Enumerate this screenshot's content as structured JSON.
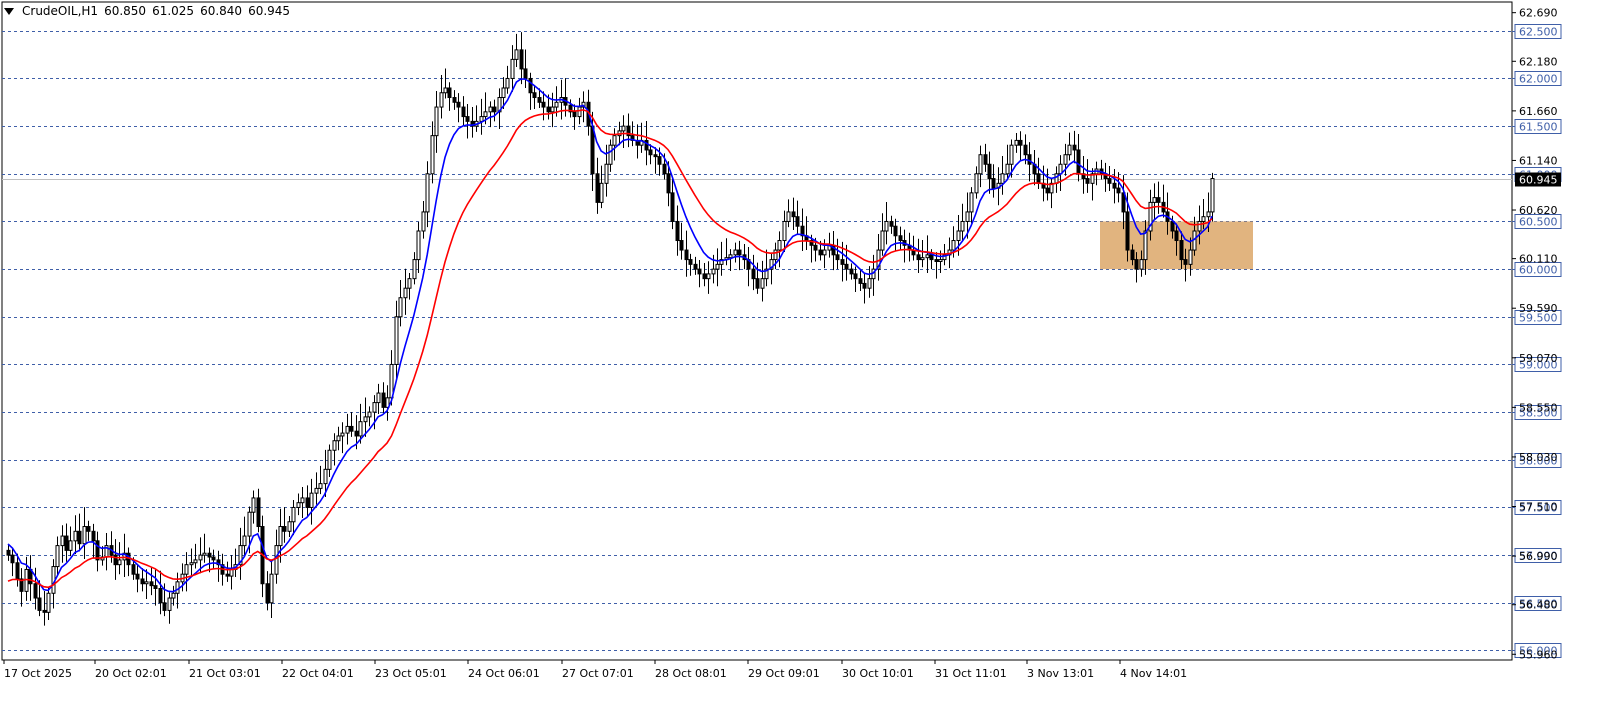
{
  "header": {
    "symbol": "CrudeOIL,H1",
    "open": "60.850",
    "high": "61.025",
    "low": "60.840",
    "close": "60.945"
  },
  "colors": {
    "grid": "#3f5fa8",
    "ema_fast": "#0000ff",
    "ema_slow": "#ff0000",
    "zone": "#d9a15f",
    "candle": "#000000",
    "price_line": "#c0c0c0"
  },
  "chart_data": {
    "type": "candlestick",
    "symbol": "CrudeOIL",
    "timeframe": "H1",
    "ylim": [
      55.9,
      62.76
    ],
    "y_ticks": [
      "62.690",
      "62.180",
      "61.660",
      "61.140",
      "60.620",
      "60.110",
      "59.590",
      "59.070",
      "58.550",
      "58.030",
      "57.510",
      "56.990",
      "56.480",
      "55.960"
    ],
    "level_lines": [
      "62.500",
      "62.000",
      "61.500",
      "61.000",
      "60.500",
      "60.000",
      "59.500",
      "59.000",
      "58.500",
      "58.000",
      "57.500",
      "57.000",
      "56.500",
      "56.000"
    ],
    "x_labels": [
      "17 Oct 2025",
      "20 Oct 02:01",
      "21 Oct 03:01",
      "22 Oct 04:01",
      "23 Oct 05:01",
      "24 Oct 06:01",
      "27 Oct 07:01",
      "28 Oct 08:01",
      "29 Oct 09:01",
      "30 Oct 10:01",
      "31 Oct 11:01",
      "3 Nov 13:01",
      "4 Nov 14:01"
    ],
    "current_price": "60.945",
    "zone": {
      "low": 60.0,
      "high": 60.5
    },
    "closes": [
      57.0,
      56.92,
      56.75,
      56.62,
      56.85,
      56.7,
      56.55,
      56.42,
      56.4,
      56.6,
      56.88,
      57.1,
      57.2,
      57.05,
      57.15,
      57.25,
      57.12,
      57.3,
      57.25,
      57.15,
      56.95,
      56.98,
      57.1,
      57.0,
      56.9,
      56.95,
      57.02,
      56.9,
      56.8,
      56.75,
      56.7,
      56.72,
      56.68,
      56.65,
      56.5,
      56.42,
      56.55,
      56.6,
      56.72,
      56.8,
      56.9,
      56.92,
      56.95,
      57.0,
      57.02,
      56.98,
      56.95,
      56.9,
      56.8,
      56.78,
      56.85,
      56.9,
      57.1,
      57.2,
      57.45,
      57.6,
      57.3,
      56.7,
      56.5,
      56.8,
      57.1,
      57.3,
      57.25,
      57.35,
      57.5,
      57.55,
      57.6,
      57.5,
      57.65,
      57.7,
      57.75,
      57.9,
      58.1,
      58.2,
      58.25,
      58.28,
      58.35,
      58.3,
      58.25,
      58.4,
      58.45,
      58.5,
      58.6,
      58.7,
      58.55,
      58.65,
      59.0,
      59.5,
      59.7,
      59.8,
      59.9,
      60.1,
      60.4,
      60.6,
      61.0,
      61.4,
      61.7,
      61.85,
      61.9,
      61.8,
      61.75,
      61.7,
      61.6,
      61.55,
      61.5,
      61.55,
      61.6,
      61.65,
      61.7,
      61.65,
      61.8,
      61.9,
      62.0,
      62.2,
      62.3,
      62.1,
      62.0,
      61.85,
      61.8,
      61.75,
      61.7,
      61.65,
      61.7,
      61.75,
      61.8,
      61.72,
      61.65,
      61.6,
      61.7,
      61.75,
      61.5,
      61.0,
      60.7,
      60.9,
      61.1,
      61.3,
      61.4,
      61.45,
      61.5,
      61.4,
      61.35,
      61.3,
      61.35,
      61.25,
      61.2,
      61.18,
      61.1,
      61.0,
      60.8,
      60.5,
      60.3,
      60.2,
      60.1,
      60.05,
      60.0,
      59.95,
      59.9,
      59.95,
      60.0,
      60.05,
      60.1,
      60.12,
      60.15,
      60.2,
      60.15,
      60.1,
      60.0,
      59.9,
      59.8,
      59.9,
      60.0,
      60.1,
      60.2,
      60.3,
      60.5,
      60.6,
      60.55,
      60.45,
      60.35,
      60.3,
      60.25,
      60.2,
      60.15,
      60.2,
      60.25,
      60.15,
      60.1,
      60.05,
      60.0,
      59.95,
      59.9,
      59.85,
      59.8,
      59.9,
      60.0,
      60.2,
      60.4,
      60.5,
      60.45,
      60.35,
      60.3,
      60.25,
      60.2,
      60.15,
      60.1,
      60.12,
      60.15,
      60.1,
      60.08,
      60.1,
      60.15,
      60.2,
      60.3,
      60.4,
      60.5,
      60.6,
      60.8,
      61.0,
      61.2,
      61.1,
      60.95,
      60.85,
      60.9,
      61.0,
      61.1,
      61.3,
      61.35,
      61.3,
      61.2,
      61.1,
      61.0,
      60.9,
      60.85,
      60.8,
      60.9,
      61.0,
      61.1,
      61.2,
      61.3,
      61.25,
      61.0,
      60.95,
      60.9,
      61.0,
      61.05,
      61.0,
      60.95,
      60.9,
      60.85,
      60.8,
      60.6,
      60.2,
      60.1,
      60.0,
      60.1,
      60.4,
      60.7,
      60.75,
      60.7,
      60.6,
      60.5,
      60.4,
      60.3,
      60.1,
      60.05,
      60.2,
      60.4,
      60.5,
      60.55,
      60.6,
      60.95
    ],
    "series": [
      {
        "name": "",
        "type": "candles"
      },
      {
        "name": "",
        "type": "line",
        "color": "#0000ff",
        "period": 8
      },
      {
        "name": "",
        "type": "line",
        "color": "#ff0000",
        "period": 21
      }
    ],
    "grid": true
  }
}
